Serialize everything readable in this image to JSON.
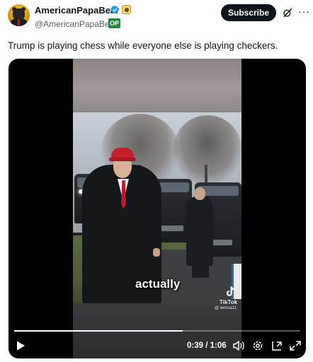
{
  "author": {
    "display_name": "AmericanPapaBear",
    "handle": "@AmericanPapaBear·",
    "badge": "OP",
    "verified_color": "#1d9bf0"
  },
  "header": {
    "subscribe_label": "Subscribe",
    "grok_icon": "grok-icon",
    "more_icon": "more-icon",
    "more_glyph": "···"
  },
  "tweet": {
    "text": "Trump is playing chess while everyone else is playing checkers."
  },
  "video": {
    "caption": "actually",
    "watermark_label": "TikTok",
    "watermark_user": "@ wnnsa11",
    "time": "0:39 / 1:06",
    "progress": 0.59,
    "controls": [
      "play-icon",
      "volume-icon",
      "settings-icon",
      "pip-icon",
      "fullscreen-icon"
    ]
  }
}
